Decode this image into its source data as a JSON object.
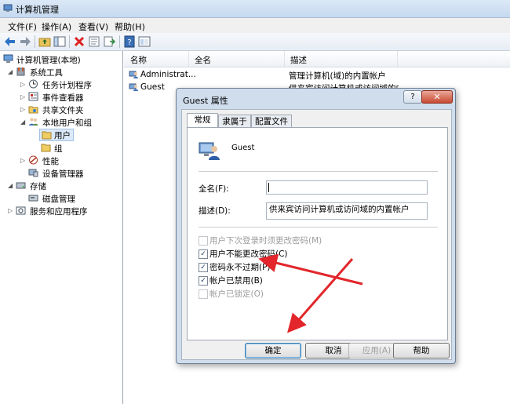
{
  "window": {
    "title": "计算机管理"
  },
  "menu": [
    "文件(F)",
    "操作(A)",
    "查看(V)",
    "帮助(H)"
  ],
  "tree": {
    "root": "计算机管理(本地)",
    "items": [
      {
        "label": "系统工具"
      },
      {
        "label": "任务计划程序"
      },
      {
        "label": "事件查看器"
      },
      {
        "label": "共享文件夹"
      },
      {
        "label": "本地用户和组"
      },
      {
        "label": "用户"
      },
      {
        "label": "组"
      },
      {
        "label": "性能"
      },
      {
        "label": "设备管理器"
      },
      {
        "label": "存储"
      },
      {
        "label": "磁盘管理"
      },
      {
        "label": "服务和应用程序"
      }
    ]
  },
  "list": {
    "columns": [
      "名称",
      "全名",
      "描述"
    ],
    "rows": [
      {
        "name": "Administrat...",
        "fullname": "",
        "desc": "管理计算机(域)的内置帐户"
      },
      {
        "name": "Guest",
        "fullname": "",
        "desc": "供来宾访问计算机或访问域的内"
      }
    ]
  },
  "dialog": {
    "title": "Guest 属性",
    "help": "?",
    "close": "✕",
    "tabs": [
      "常规",
      "隶属于",
      "配置文件"
    ],
    "username": "Guest",
    "fullname_label": "全名(F):",
    "fullname_value": "",
    "desc_label": "描述(D):",
    "desc_value": "供来宾访问计算机或访问域的内置帐户",
    "checks": [
      {
        "label": "用户下次登录时须更改密码(M)",
        "checked": false,
        "disabled": true
      },
      {
        "label": "用户不能更改密码(C)",
        "checked": true,
        "disabled": false
      },
      {
        "label": "密码永不过期(P)",
        "checked": true,
        "disabled": false
      },
      {
        "label": "帐户已禁用(B)",
        "checked": true,
        "disabled": false
      },
      {
        "label": "帐户已锁定(O)",
        "checked": false,
        "disabled": true
      }
    ],
    "buttons": [
      "确定",
      "取消",
      "应用(A)",
      "帮助"
    ]
  },
  "colors": {
    "arrow": "#e2262b",
    "dialog_frame": "#cfdded"
  }
}
